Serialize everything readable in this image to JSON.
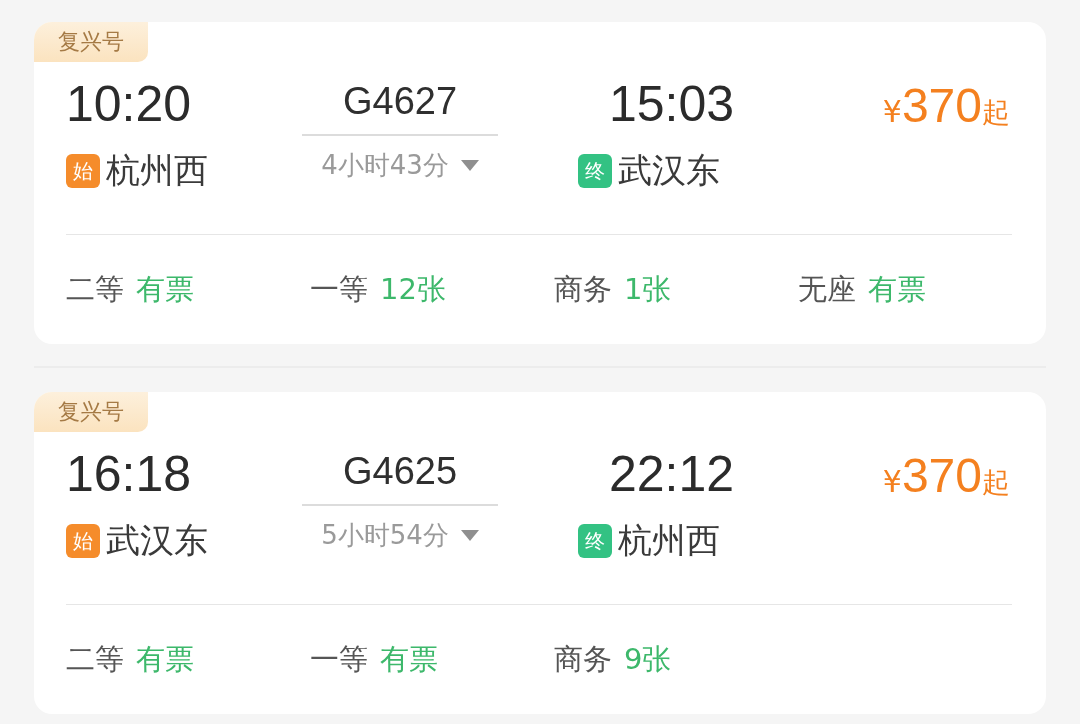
{
  "trains": [
    {
      "badge": "复兴号",
      "depart_time": "10:20",
      "depart_tag": {
        "kind": "start",
        "label": "始"
      },
      "depart_station": "杭州西",
      "train_no": "G4627",
      "duration": "4小时43分",
      "arrive_time": "15:03",
      "arrive_tag": {
        "kind": "end",
        "label": "终"
      },
      "arrive_station": "武汉东",
      "price": {
        "currency": "¥",
        "amount": "370",
        "suffix": "起"
      },
      "seats": [
        {
          "class": "二等",
          "availability": "有票"
        },
        {
          "class": "一等",
          "availability": "12张"
        },
        {
          "class": "商务",
          "availability": "1张"
        },
        {
          "class": "无座",
          "availability": "有票"
        }
      ]
    },
    {
      "badge": "复兴号",
      "depart_time": "16:18",
      "depart_tag": {
        "kind": "start",
        "label": "始"
      },
      "depart_station": "武汉东",
      "train_no": "G4625",
      "duration": "5小时54分",
      "arrive_time": "22:12",
      "arrive_tag": {
        "kind": "end",
        "label": "终"
      },
      "arrive_station": "杭州西",
      "price": {
        "currency": "¥",
        "amount": "370",
        "suffix": "起"
      },
      "seats": [
        {
          "class": "二等",
          "availability": "有票"
        },
        {
          "class": "一等",
          "availability": "有票"
        },
        {
          "class": "商务",
          "availability": "9张"
        }
      ]
    }
  ]
}
